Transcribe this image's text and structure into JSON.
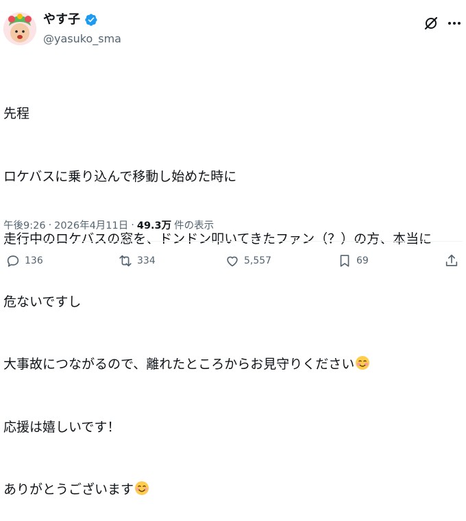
{
  "user": {
    "display_name": "やす子",
    "handle": "@yasuko_sma",
    "avatar_icon": "avatar-photo",
    "verified_icon": "verified-badge-icon"
  },
  "header_actions": {
    "grok_icon": "grok-icon",
    "more_icon": "more-icon"
  },
  "post": {
    "lines": [
      "先程",
      "ロケバスに乗り込んで移動し始めた時に",
      "走行中のロケバスの窓を、ドンドン叩いてきたファン（？）の方、本当に",
      "危ないですし",
      "大事故につながるので、離れたところからお見守りください",
      "応援は嬉しいです！",
      "ありがとうございます"
    ],
    "emoji_line5": "smiling-face-with-blush-emoji",
    "emoji_line7": "smiling-face-emoji"
  },
  "meta": {
    "time": "午後9:26",
    "separator1": "·",
    "date": "2026年4月11日",
    "separator2": "·",
    "views": "49.3万",
    "views_label": "件の表示"
  },
  "actions": {
    "replies": "136",
    "reposts": "334",
    "likes": "5,557",
    "bookmarks": "69"
  },
  "colors": {
    "text": "#0f1419",
    "secondary": "#536471",
    "verified": "#1d9bf0"
  }
}
